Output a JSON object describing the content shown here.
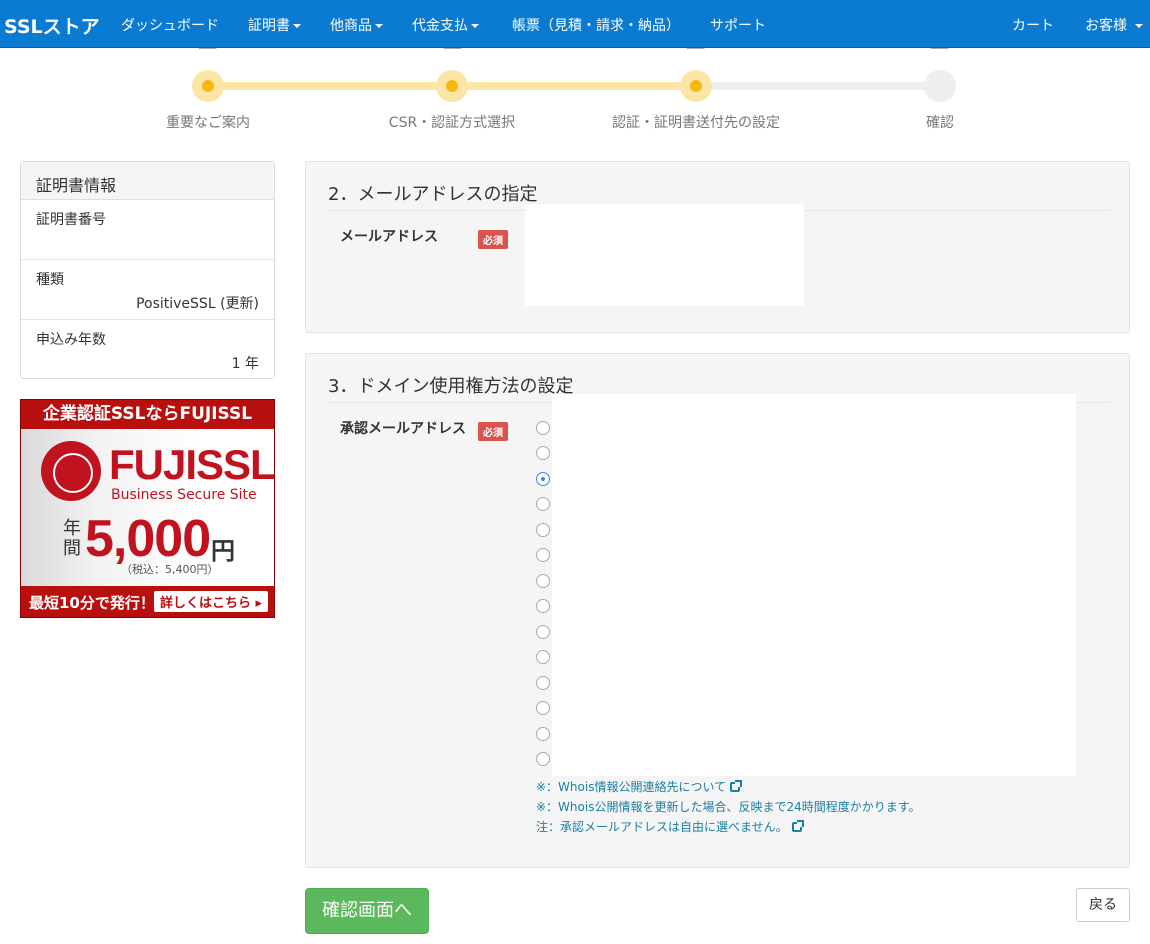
{
  "navbar": {
    "brand": "SSLストア",
    "items": [
      {
        "label": "ダッシュボード",
        "dropdown": false
      },
      {
        "label": "証明書",
        "dropdown": true
      },
      {
        "label": "他商品",
        "dropdown": true
      },
      {
        "label": "代金支払",
        "dropdown": true
      },
      {
        "label": "帳票（見積・請求・納品）",
        "dropdown": false
      },
      {
        "label": "サポート",
        "dropdown": false
      }
    ],
    "cart": "カート",
    "account": "お客様"
  },
  "steps": [
    {
      "label": "重要なご案内",
      "state": "done"
    },
    {
      "label": "CSR・認証方式選択",
      "state": "done"
    },
    {
      "label": "認証・証明書送付先の設定",
      "state": "current"
    },
    {
      "label": "確認",
      "state": "todo"
    }
  ],
  "cert_info": {
    "heading": "証明書情報",
    "rows": [
      {
        "label": "証明書番号",
        "value": ""
      },
      {
        "label": "種類",
        "value": "PositiveSSL (更新)"
      },
      {
        "label": "申込み年数",
        "value": "1 年"
      }
    ]
  },
  "banner": {
    "top": "企業認証SSLならFUJISSL",
    "brand": "FUJISSL",
    "subtitle": "Business Secure Site",
    "nenkan": "年間",
    "price": "5,000",
    "yen": "円",
    "tax": "（税込：5,400円）",
    "bottom": "最短10分で発行！",
    "cta": "詳しくはこちら ▸"
  },
  "mail_section": {
    "title": "2．メールアドレスの指定",
    "field_label": "メールアドレス",
    "required": "必須"
  },
  "domain_section": {
    "title": "3．ドメイン使用権方法の設定",
    "field_label": "承認メールアドレス",
    "required": "必須",
    "radio_options": [
      {
        "checked": false
      },
      {
        "checked": false
      },
      {
        "checked": true
      },
      {
        "checked": false
      },
      {
        "checked": false
      },
      {
        "checked": false
      },
      {
        "checked": false
      },
      {
        "checked": false
      },
      {
        "checked": false
      },
      {
        "checked": false
      },
      {
        "checked": false
      },
      {
        "checked": false
      },
      {
        "checked": false
      },
      {
        "checked": false
      }
    ],
    "notes": [
      "※：Whois情報公開連絡先について",
      "※：Whois公開情報を更新した場合、反映まで24時間程度かかります。",
      "注：承認メールアドレスは自由に選べません。"
    ]
  },
  "buttons": {
    "confirm": "確認画面へ",
    "back": "戻る"
  },
  "colors": {
    "navbar": "#0a7bd1",
    "step_active": "#f6b80c",
    "required_badge": "#d9534f",
    "confirm_button": "#5cb85c",
    "banner_red": "#b80f0f"
  }
}
